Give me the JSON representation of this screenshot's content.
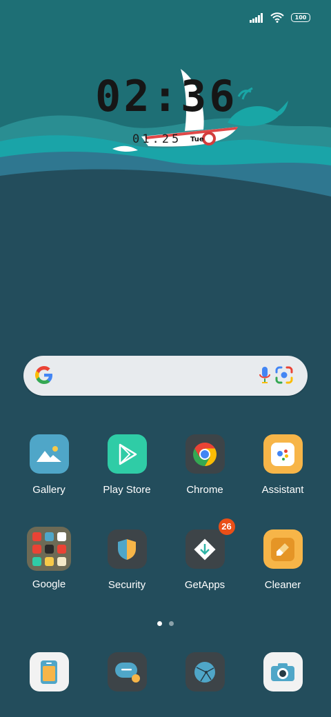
{
  "status_bar": {
    "battery": "100",
    "signal_icon": "signal-icon",
    "wifi_icon": "wifi-icon"
  },
  "clock_widget": {
    "time": "02:36",
    "date": "01.25",
    "weekday": "Tue"
  },
  "search_bar": {
    "logo": "google-g-icon",
    "mic": "mic-icon",
    "lens": "lens-icon"
  },
  "apps": [
    {
      "label": "Gallery",
      "icon": "gallery-icon",
      "color": "#4fa6c8"
    },
    {
      "label": "Play Store",
      "icon": "play-store-icon",
      "color": "#2fcca6"
    },
    {
      "label": "Chrome",
      "icon": "chrome-icon",
      "color": "#3d4448"
    },
    {
      "label": "Assistant",
      "icon": "assistant-icon",
      "color": "#f7b548"
    },
    {
      "label": "Google",
      "icon": "google-folder-icon",
      "color": "#6d6a55"
    },
    {
      "label": "Security",
      "icon": "security-icon",
      "color": "#3d4448"
    },
    {
      "label": "GetApps",
      "icon": "getapps-icon",
      "color": "#3d4448",
      "badge": "26"
    },
    {
      "label": "Cleaner",
      "icon": "cleaner-icon",
      "color": "#f7b548"
    }
  ],
  "page_indicator": {
    "pages": 2,
    "current": 1
  },
  "dock": [
    {
      "icon": "phone-icon"
    },
    {
      "icon": "messages-icon"
    },
    {
      "icon": "browser-icon"
    },
    {
      "icon": "camera-icon"
    }
  ]
}
